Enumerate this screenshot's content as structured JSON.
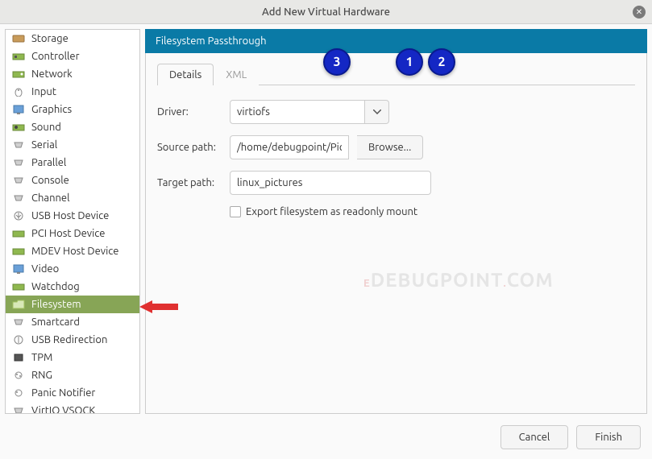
{
  "window": {
    "title": "Add New Virtual Hardware"
  },
  "sidebar": {
    "items": [
      {
        "label": "Storage",
        "icon": "storage"
      },
      {
        "label": "Controller",
        "icon": "controller"
      },
      {
        "label": "Network",
        "icon": "network"
      },
      {
        "label": "Input",
        "icon": "input"
      },
      {
        "label": "Graphics",
        "icon": "graphics"
      },
      {
        "label": "Sound",
        "icon": "sound"
      },
      {
        "label": "Serial",
        "icon": "serial"
      },
      {
        "label": "Parallel",
        "icon": "parallel"
      },
      {
        "label": "Console",
        "icon": "console"
      },
      {
        "label": "Channel",
        "icon": "channel"
      },
      {
        "label": "USB Host Device",
        "icon": "usb"
      },
      {
        "label": "PCI Host Device",
        "icon": "pci"
      },
      {
        "label": "MDEV Host Device",
        "icon": "mdev"
      },
      {
        "label": "Video",
        "icon": "video"
      },
      {
        "label": "Watchdog",
        "icon": "watchdog"
      },
      {
        "label": "Filesystem",
        "icon": "filesystem",
        "selected": true
      },
      {
        "label": "Smartcard",
        "icon": "smartcard"
      },
      {
        "label": "USB Redirection",
        "icon": "usb-redir"
      },
      {
        "label": "TPM",
        "icon": "tpm"
      },
      {
        "label": "RNG",
        "icon": "rng"
      },
      {
        "label": "Panic Notifier",
        "icon": "panic"
      },
      {
        "label": "VirtIO VSOCK",
        "icon": "vsock"
      }
    ]
  },
  "panel": {
    "title": "Filesystem Passthrough",
    "tabs": {
      "details": "Details",
      "xml": "XML"
    },
    "driver_label": "Driver:",
    "driver_value": "virtiofs",
    "source_label": "Source path:",
    "source_value": "/home/debugpoint/Pictu",
    "browse_label": "Browse...",
    "target_label": "Target path:",
    "target_value": "linux_pictures",
    "readonly_label": "Export filesystem as readonly mount"
  },
  "footer": {
    "cancel": "Cancel",
    "finish": "Finish"
  },
  "annotations": {
    "n1": "1",
    "n2": "2",
    "n3": "3"
  },
  "watermark": "DEBUGPOINT.COM"
}
